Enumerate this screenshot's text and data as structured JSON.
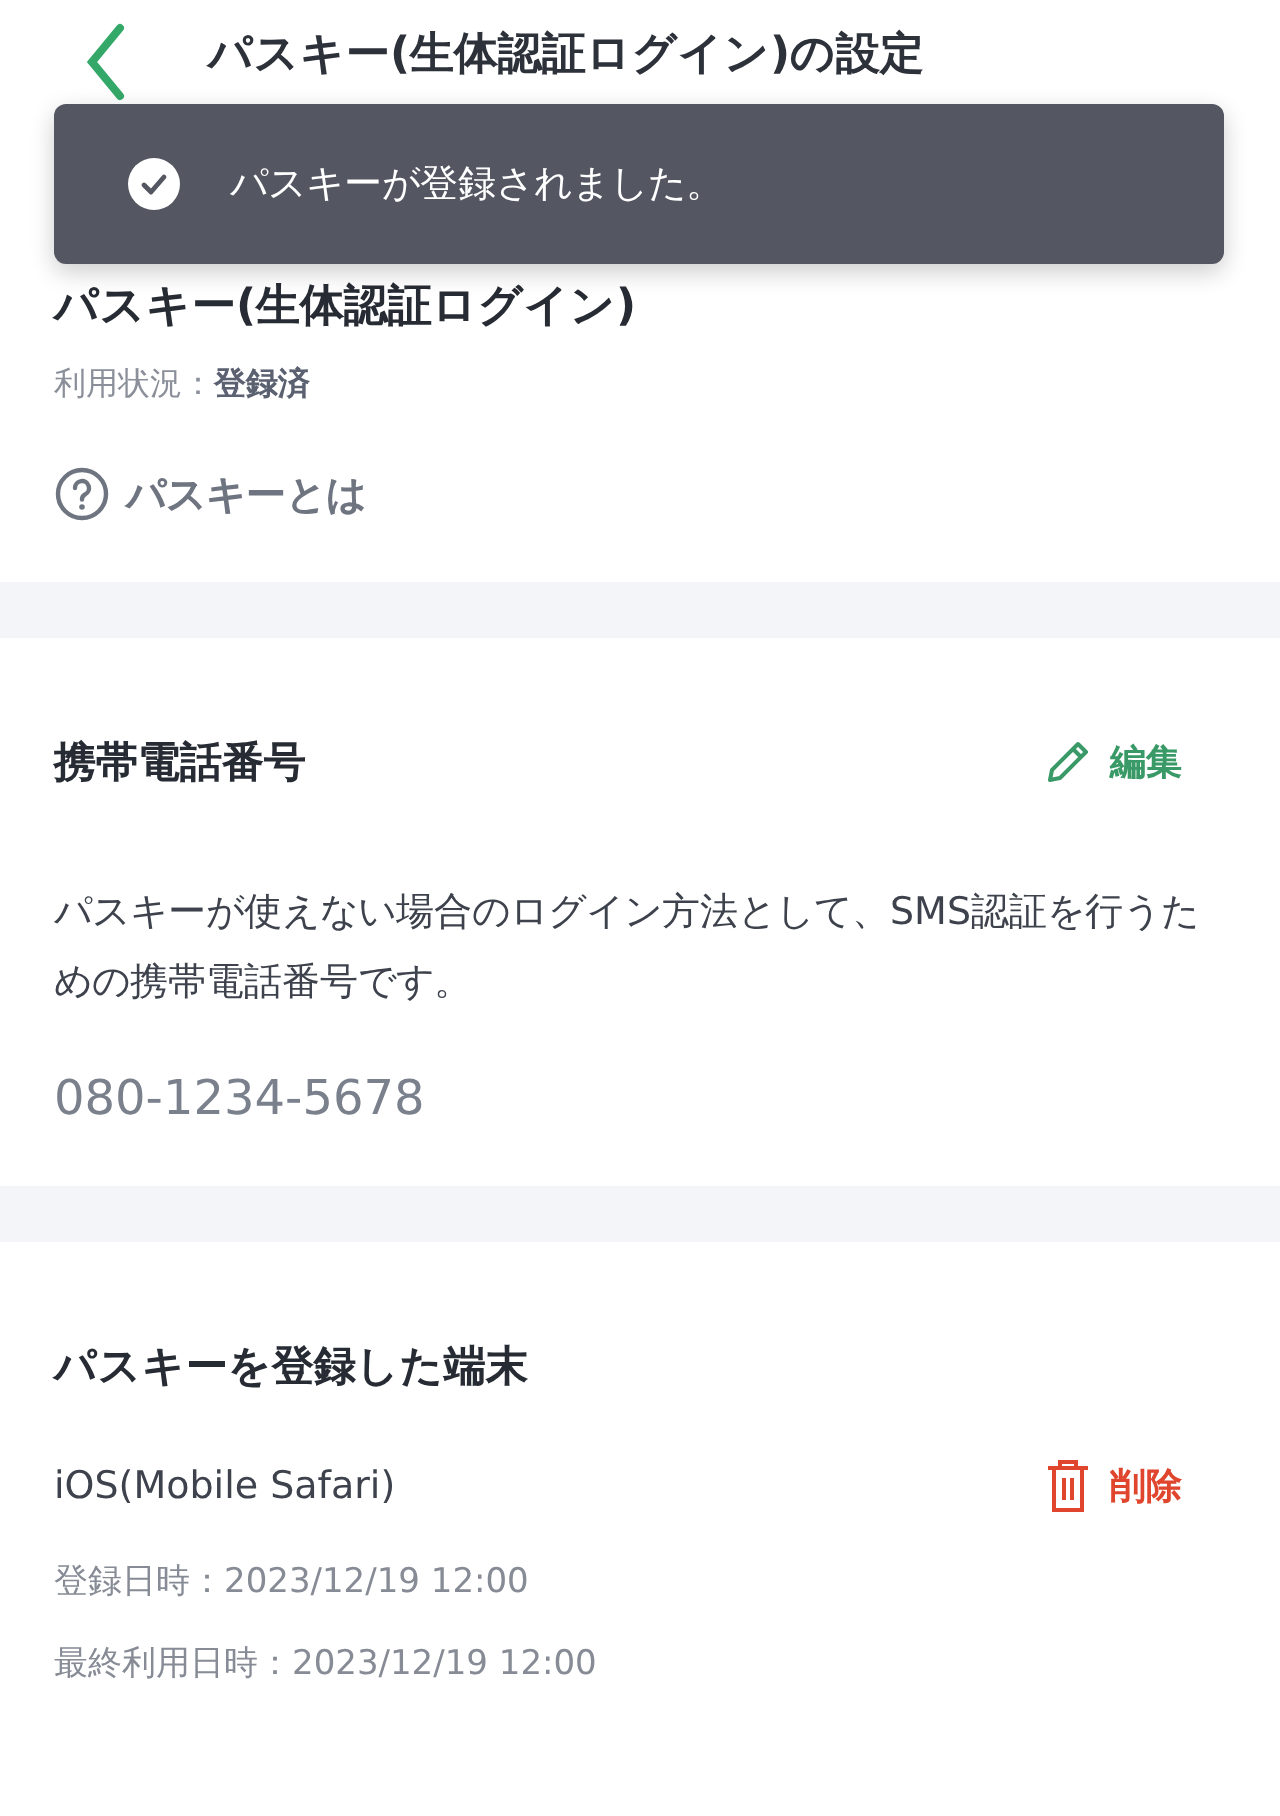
{
  "header": {
    "title": "パスキー(生体認証ログイン)の設定"
  },
  "toast": {
    "message": "パスキーが登録されました。"
  },
  "passkey": {
    "title": "パスキー(生体認証ログイン)",
    "status_label": "利用状況：",
    "status_value": "登録済",
    "help_link": "パスキーとは"
  },
  "phone": {
    "title": "携帯電話番号",
    "edit": "編集",
    "description": "パスキーが使えない場合のログイン方法として、SMS認証を行うための携帯電話番号です。",
    "number": "080-1234-5678"
  },
  "devices": {
    "title": "パスキーを登録した端末",
    "items": [
      {
        "name": "iOS(Mobile Safari)",
        "delete": "削除",
        "registered": "登録日時：2023/12/19 12:00",
        "last_used": "最終利用日時：2023/12/19 12:00"
      }
    ]
  }
}
